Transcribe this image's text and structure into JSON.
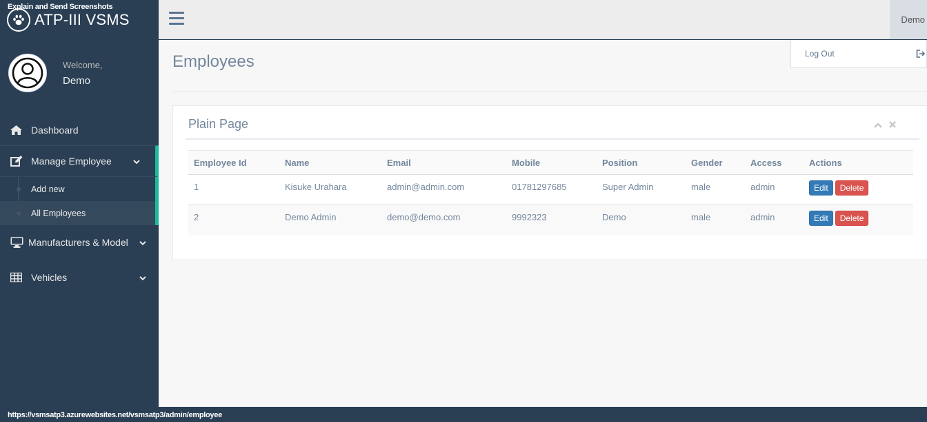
{
  "overlay_caption": "Explain and Send Screenshots",
  "brand": {
    "title": "ATP-III VSMS",
    "icon": "paw-icon"
  },
  "profile": {
    "welcome": "Welcome,",
    "name": "Demo"
  },
  "sidebar": {
    "items": [
      {
        "label": "Dashboard",
        "icon": "home-icon"
      },
      {
        "label": "Manage Employee",
        "icon": "edit-icon"
      },
      {
        "label": "Manufacturers & Model",
        "icon": "desktop-icon"
      },
      {
        "label": "Vehicles",
        "icon": "table-icon"
      }
    ],
    "submenu": [
      {
        "label": "Add new"
      },
      {
        "label": "All Employees"
      }
    ]
  },
  "topnav": {
    "user": "Demo",
    "menu_icon": "hamburger-icon"
  },
  "dropdown": {
    "logout": "Log Out",
    "icon": "sign-out-icon"
  },
  "page": {
    "title": "Employees"
  },
  "panel": {
    "title": "Plain Page"
  },
  "table": {
    "headers": [
      "Employee Id",
      "Name",
      "Email",
      "Mobile",
      "Position",
      "Gender",
      "Access",
      "Actions"
    ],
    "rows": [
      [
        "1",
        "Kisuke Urahara",
        "admin@admin.com",
        "01781297685",
        "Super Admin",
        "male",
        "admin"
      ],
      [
        "2",
        "Demo Admin",
        "demo@demo.com",
        "9992323",
        "Demo",
        "male",
        "admin"
      ]
    ],
    "edit_label": "Edit",
    "delete_label": "Delete"
  },
  "status_url": "https://vsmsatp3.azurewebsites.net/vsmsatp3/admin/employee",
  "colors": {
    "sidebar": "#2a3f54",
    "accent": "#1abb9c",
    "edit": "#337ab7",
    "delete": "#d9534f"
  }
}
